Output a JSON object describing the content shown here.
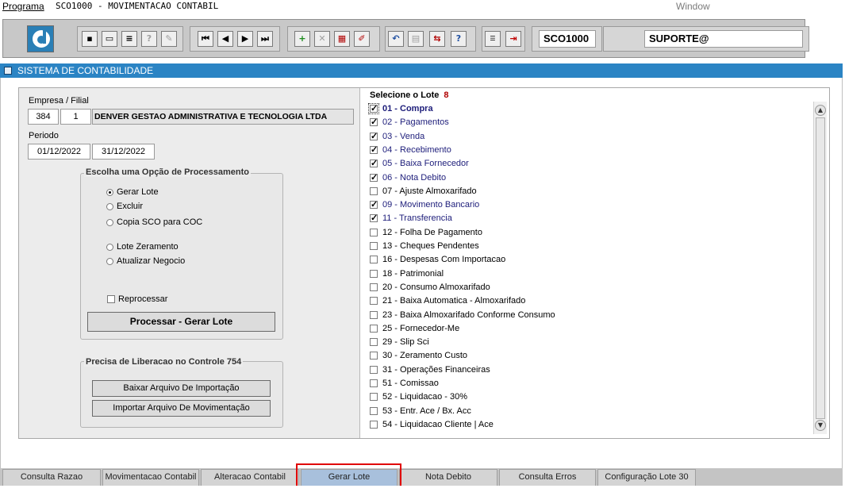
{
  "menubar": {
    "program": "Programa",
    "title": "SCO1000 - MOVIMENTACAO CONTABIL",
    "window": "Window"
  },
  "toolbar": {
    "program_code": "SCO1000",
    "user": "SUPORTE@",
    "buttons": [
      "save-icon",
      "window-icon",
      "print-icon",
      "help-query-icon",
      "edit-query-icon",
      "first-record-icon",
      "prev-record-icon",
      "next-record-icon",
      "last-record-icon",
      "add-icon",
      "delete-icon",
      "clear-icon",
      "eraser-icon",
      "undo-icon",
      "paste-icon",
      "duplicate-icon",
      "help-icon",
      "menu-icon",
      "exit-icon"
    ]
  },
  "window_title": "SISTEMA DE CONTABILIDADE",
  "form": {
    "empresa_label": "Empresa / Filial",
    "empresa": "384",
    "filial": "1",
    "empresa_nome": "DENVER GESTAO ADMINISTRATIVA E TECNOLOGIA LTDA",
    "periodo_label": "Periodo",
    "periodo_inicio": "01/12/2022",
    "periodo_fim": "31/12/2022"
  },
  "processing": {
    "title": "Escolha uma Opção de Processamento",
    "options": [
      "Gerar Lote",
      "Excluir",
      "Copia SCO para COC",
      "Lote Zeramento",
      "Atualizar Negocio"
    ],
    "selected": "Gerar Lote",
    "reprocess_label": "Reprocessar",
    "process_button": "Processar - Gerar Lote"
  },
  "liberacao": {
    "title": "Precisa de Liberacao no Controle 754",
    "download_button": "Baixar Arquivo De Importação",
    "import_button": "Importar Arquivo De Movimentação"
  },
  "lots": {
    "title": "Selecione o Lote",
    "count": "8",
    "items": [
      {
        "label": "01 - Compra",
        "checked": true
      },
      {
        "label": "02 - Pagamentos",
        "checked": true
      },
      {
        "label": "03 - Venda",
        "checked": true
      },
      {
        "label": "04 - Recebimento",
        "checked": true
      },
      {
        "label": "05 - Baixa Fornecedor",
        "checked": true
      },
      {
        "label": "06 - Nota Debito",
        "checked": true
      },
      {
        "label": "07 - Ajuste Almoxarifado",
        "checked": false
      },
      {
        "label": "09 - Movimento Bancario",
        "checked": true
      },
      {
        "label": "11 - Transferencia",
        "checked": true
      },
      {
        "label": "12 - Folha De Pagamento",
        "checked": false
      },
      {
        "label": "13 - Cheques Pendentes",
        "checked": false
      },
      {
        "label": "16 - Despesas Com Importacao",
        "checked": false
      },
      {
        "label": "18 - Patrimonial",
        "checked": false
      },
      {
        "label": "20 - Consumo Almoxarifado",
        "checked": false
      },
      {
        "label": "21 - Baixa Automatica - Almoxarifado",
        "checked": false
      },
      {
        "label": "23 - Baixa Almoxarifado Conforme Consumo",
        "checked": false
      },
      {
        "label": "25 - Fornecedor-Me",
        "checked": false
      },
      {
        "label": "29 - Slip Sci",
        "checked": false
      },
      {
        "label": "30 - Zeramento Custo",
        "checked": false
      },
      {
        "label": "31 - Operações Financeiras",
        "checked": false
      },
      {
        "label": "51 - Comissao",
        "checked": false
      },
      {
        "label": "52 - Liquidacao - 30%",
        "checked": false
      },
      {
        "label": "53 - Entr. Ace / Bx. Acc",
        "checked": false
      },
      {
        "label": "54 - Liquidacao Cliente | Ace",
        "checked": false
      }
    ]
  },
  "tabs": [
    "Consulta Razao",
    "Movimentacao Contabil",
    "Alteracao Contabil",
    "Gerar Lote",
    "Nota Debito",
    "Consulta Erros",
    "Configuração Lote 30"
  ],
  "active_tab": "Gerar Lote"
}
